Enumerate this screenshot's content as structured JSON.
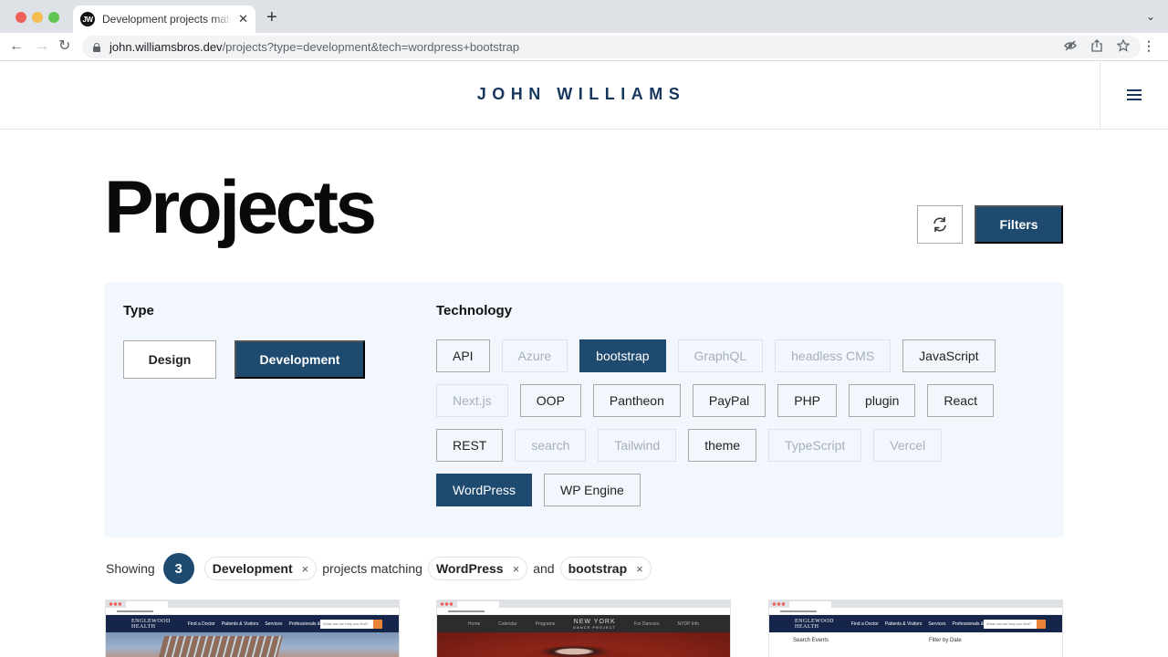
{
  "browser": {
    "tab_title": "Development projects matching WordPress and bootstrap",
    "favicon_text": "JW",
    "url_host": "john.williamsbros.dev",
    "url_path": "/projects?type=development&tech=wordpress+bootstrap",
    "icons": [
      "eye-off-icon",
      "share-icon",
      "star-icon"
    ]
  },
  "header": {
    "logo": "JOHN WILLIAMS",
    "menu_icon": "hamburger-icon"
  },
  "page": {
    "title": "Projects",
    "refresh_icon": "refresh-icon",
    "filters_label": "Filters"
  },
  "filters": {
    "type_label": "Type",
    "types": [
      {
        "label": "Design",
        "state": "available"
      },
      {
        "label": "Development",
        "state": "active"
      }
    ],
    "tech_label": "Technology",
    "technologies": [
      {
        "label": "API",
        "state": "available"
      },
      {
        "label": "Azure",
        "state": "disabled"
      },
      {
        "label": "bootstrap",
        "state": "active"
      },
      {
        "label": "GraphQL",
        "state": "disabled"
      },
      {
        "label": "headless CMS",
        "state": "disabled"
      },
      {
        "label": "JavaScript",
        "state": "available"
      },
      {
        "label": "Next.js",
        "state": "disabled"
      },
      {
        "label": "OOP",
        "state": "available"
      },
      {
        "label": "Pantheon",
        "state": "available"
      },
      {
        "label": "PayPal",
        "state": "available"
      },
      {
        "label": "PHP",
        "state": "available"
      },
      {
        "label": "plugin",
        "state": "available"
      },
      {
        "label": "React",
        "state": "available"
      },
      {
        "label": "REST",
        "state": "available"
      },
      {
        "label": "search",
        "state": "disabled"
      },
      {
        "label": "Tailwind",
        "state": "disabled"
      },
      {
        "label": "theme",
        "state": "available"
      },
      {
        "label": "TypeScript",
        "state": "disabled"
      },
      {
        "label": "Vercel",
        "state": "disabled"
      },
      {
        "label": "WordPress",
        "state": "active"
      },
      {
        "label": "WP Engine",
        "state": "available"
      }
    ]
  },
  "summary": {
    "showing": "Showing",
    "count": "3",
    "type_pill": "Development",
    "projects_matching": "projects matching",
    "tech_pill_1": "WordPress",
    "and": "and",
    "tech_pill_2": "bootstrap",
    "remove_glyph": "×"
  },
  "projects": [
    {
      "thumb_logo_1": "ENGLEWOOD",
      "thumb_logo_2": "HEALTH",
      "thumb_nav": [
        "Find a Doctor",
        "Patients & Visitors",
        "Services",
        "Professionals & Students"
      ],
      "thumb_search": "What can we help you find?"
    },
    {
      "thumb_logo_1": "NEW YORK",
      "thumb_logo_2": "DANCE PROJECT",
      "thumb_nav_left": [
        "Home",
        "Calendar",
        "Programs"
      ],
      "thumb_nav_right": [
        "For Dancers",
        "NYDP Info"
      ]
    },
    {
      "thumb_logo_1": "ENGLEWOOD",
      "thumb_logo_2": "HEALTH",
      "thumb_nav": [
        "Find a Doctor",
        "Patients & Visitors",
        "Services",
        "Professionals & Students"
      ],
      "thumb_search": "What can we help you find?",
      "thumb_heading_1": "Search Events",
      "thumb_heading_2": "Filter by Date"
    }
  ],
  "colors": {
    "brand": "#1f4a70",
    "logo": "#17375e",
    "panel_bg": "#f1f7fc"
  }
}
